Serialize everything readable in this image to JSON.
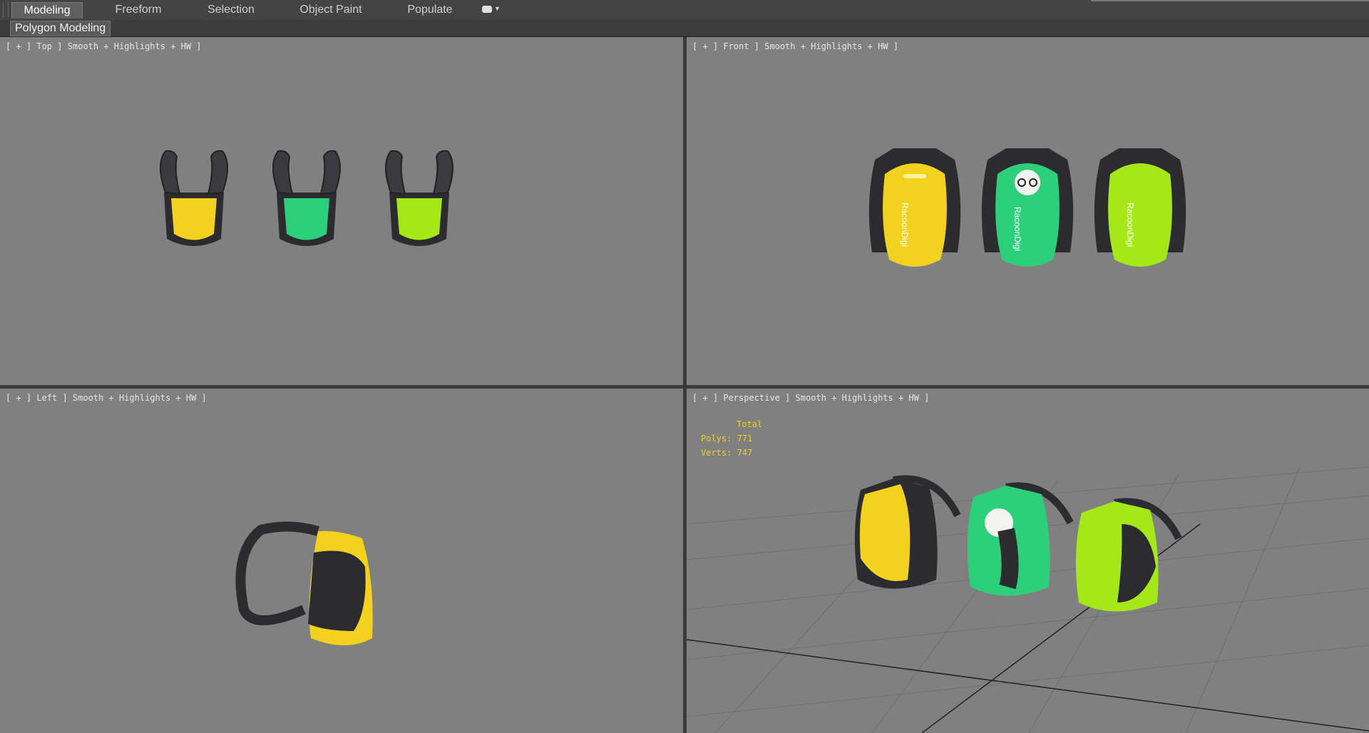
{
  "ribbon": {
    "tabs": [
      "Modeling",
      "Freeform",
      "Selection",
      "Object Paint",
      "Populate"
    ],
    "active": "Modeling"
  },
  "subbar": {
    "label": "Polygon Modeling"
  },
  "viewports": {
    "top": {
      "label": "[ + ] Top ] Smooth + Highlights + HW ]"
    },
    "front": {
      "label": "[ + ] Front ] Smooth + Highlights + HW ]"
    },
    "left": {
      "label": "[ + ] Left ] Smooth + Highlights + HW ]"
    },
    "perspective": {
      "label": "[ + ] Perspective ] Smooth + Highlights + HW ]"
    }
  },
  "stats": {
    "title": "Total",
    "polys": "Polys: 771",
    "verts": "Verts: 747"
  },
  "backpacks": {
    "brand_text": "RacoonDigi",
    "colors": [
      "#f2d21e",
      "#2ecf7a",
      "#a5e81a"
    ],
    "strap_color": "#2b2b30"
  }
}
